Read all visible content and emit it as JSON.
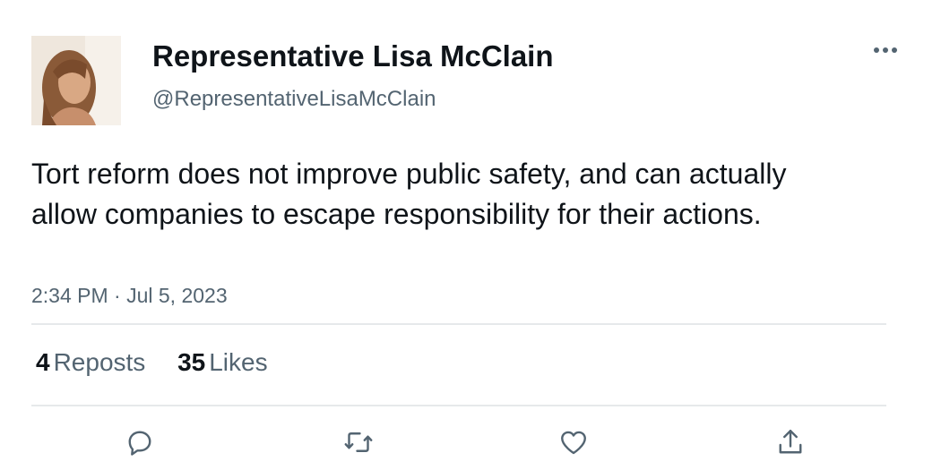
{
  "author": {
    "display_name": "Representative Lisa McClain",
    "handle": "@RepresentativeLisaMcClain",
    "avatar_icon": "profile-photo"
  },
  "tweet": {
    "text": "Tort reform does not improve public safety, and can actually allow companies to escape responsibility for their actions.",
    "timestamp": "2:34 PM · Jul 5, 2023"
  },
  "stats": {
    "reposts_count": "4",
    "reposts_label": "Reposts",
    "likes_count": "35",
    "likes_label": "Likes"
  },
  "actions": [
    {
      "icon": "reply-icon"
    },
    {
      "icon": "repost-icon"
    },
    {
      "icon": "like-icon"
    },
    {
      "icon": "share-icon"
    }
  ],
  "colors": {
    "text_primary": "#0f1419",
    "text_secondary": "#536471",
    "divider": "#e6e9eb"
  }
}
